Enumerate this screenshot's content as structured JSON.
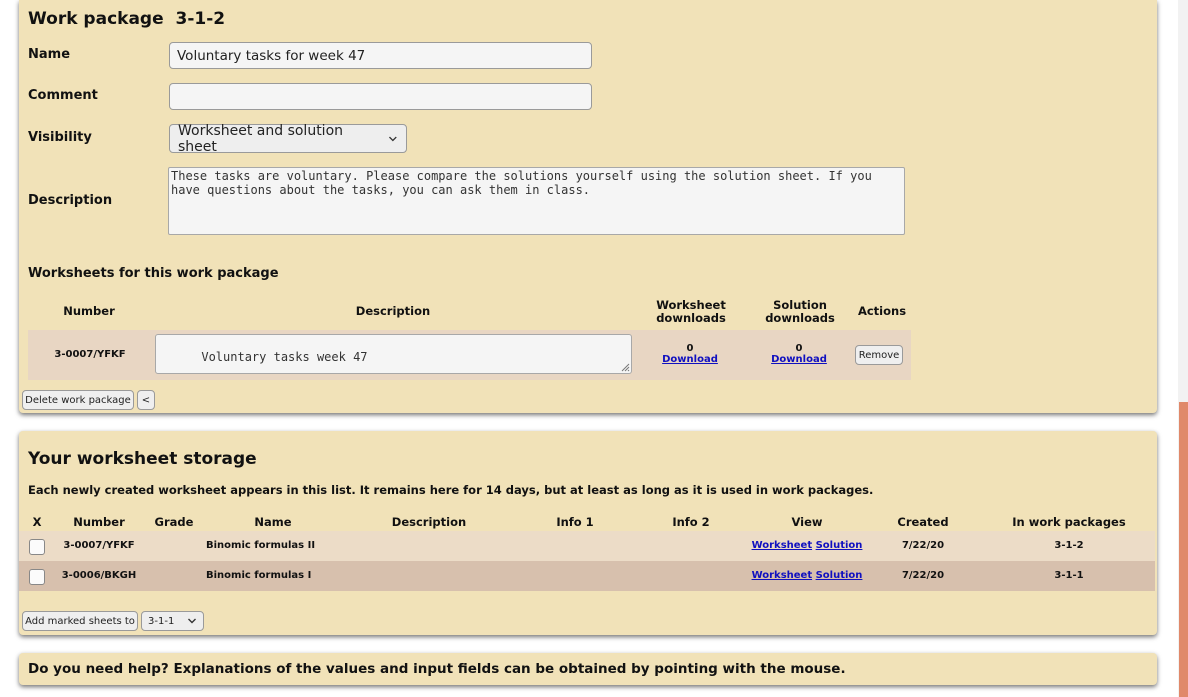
{
  "work_package": {
    "title": "Work package",
    "number": "3-1-2",
    "name_label": "Name",
    "name_value": "Voluntary tasks for week 47",
    "comment_label": "Comment",
    "comment_value": "",
    "visibility_label": "Visibility",
    "visibility_value": "Worksheet and solution sheet",
    "description_label": "Description",
    "description_value": "These tasks are voluntary. Please compare the solutions yourself using the solution sheet. If you have questions about the tasks, you can ask them in class.",
    "worksheets_heading": "Worksheets for this work package",
    "table_headers": {
      "number": "Number",
      "description": "Description",
      "worksheet_downloads": "Worksheet downloads",
      "solution_downloads": "Solution downloads",
      "actions": "Actions"
    },
    "rows": [
      {
        "number": "3-0007/YFKF",
        "description": "Voluntary tasks week 47",
        "worksheet_downloads": "0",
        "worksheet_download_link": "Download",
        "solution_downloads": "0",
        "solution_download_link": "Download",
        "remove_label": "Remove"
      }
    ],
    "delete_button": "Delete work package",
    "back_button": "<"
  },
  "storage": {
    "title": "Your worksheet storage",
    "info": "Each newly created worksheet appears in this list. It remains here for 14 days, but at least as long as it is used in work packages.",
    "headers": {
      "x": "X",
      "number": "Number",
      "grade": "Grade",
      "name": "Name",
      "description": "Description",
      "info1": "Info 1",
      "info2": "Info 2",
      "view": "View",
      "created": "Created",
      "in_work_packages": "In work packages"
    },
    "rows": [
      {
        "number": "3-0007/YFKF",
        "grade": "",
        "name": "Binomic formulas II",
        "description": "",
        "info1": "",
        "info2": "",
        "worksheet_link": "Worksheet",
        "solution_link": "Solution",
        "created": "7/22/20",
        "in_work_packages": "3-1-2"
      },
      {
        "number": "3-0006/BKGH",
        "grade": "",
        "name": "Binomic formulas I",
        "description": "",
        "info1": "",
        "info2": "",
        "worksheet_link": "Worksheet",
        "solution_link": "Solution",
        "created": "7/22/20",
        "in_work_packages": "3-1-1"
      }
    ],
    "row_colors": [
      "#ecdcc7",
      "#d7c0ad"
    ],
    "add_button": "Add marked sheets to",
    "target_select": "3-1-1"
  },
  "help": {
    "text": "Do you need help? Explanations of the values and input fields can be obtained by pointing with the mouse."
  },
  "colors": {
    "panel_background": "#f1e2b8",
    "worksheet_row": "#e8d6c3",
    "link": "#1010c0",
    "scrollbar_thumb": "#e0896a"
  },
  "icons": [
    "chevron-down-icon",
    "resize-handle-icon"
  ]
}
